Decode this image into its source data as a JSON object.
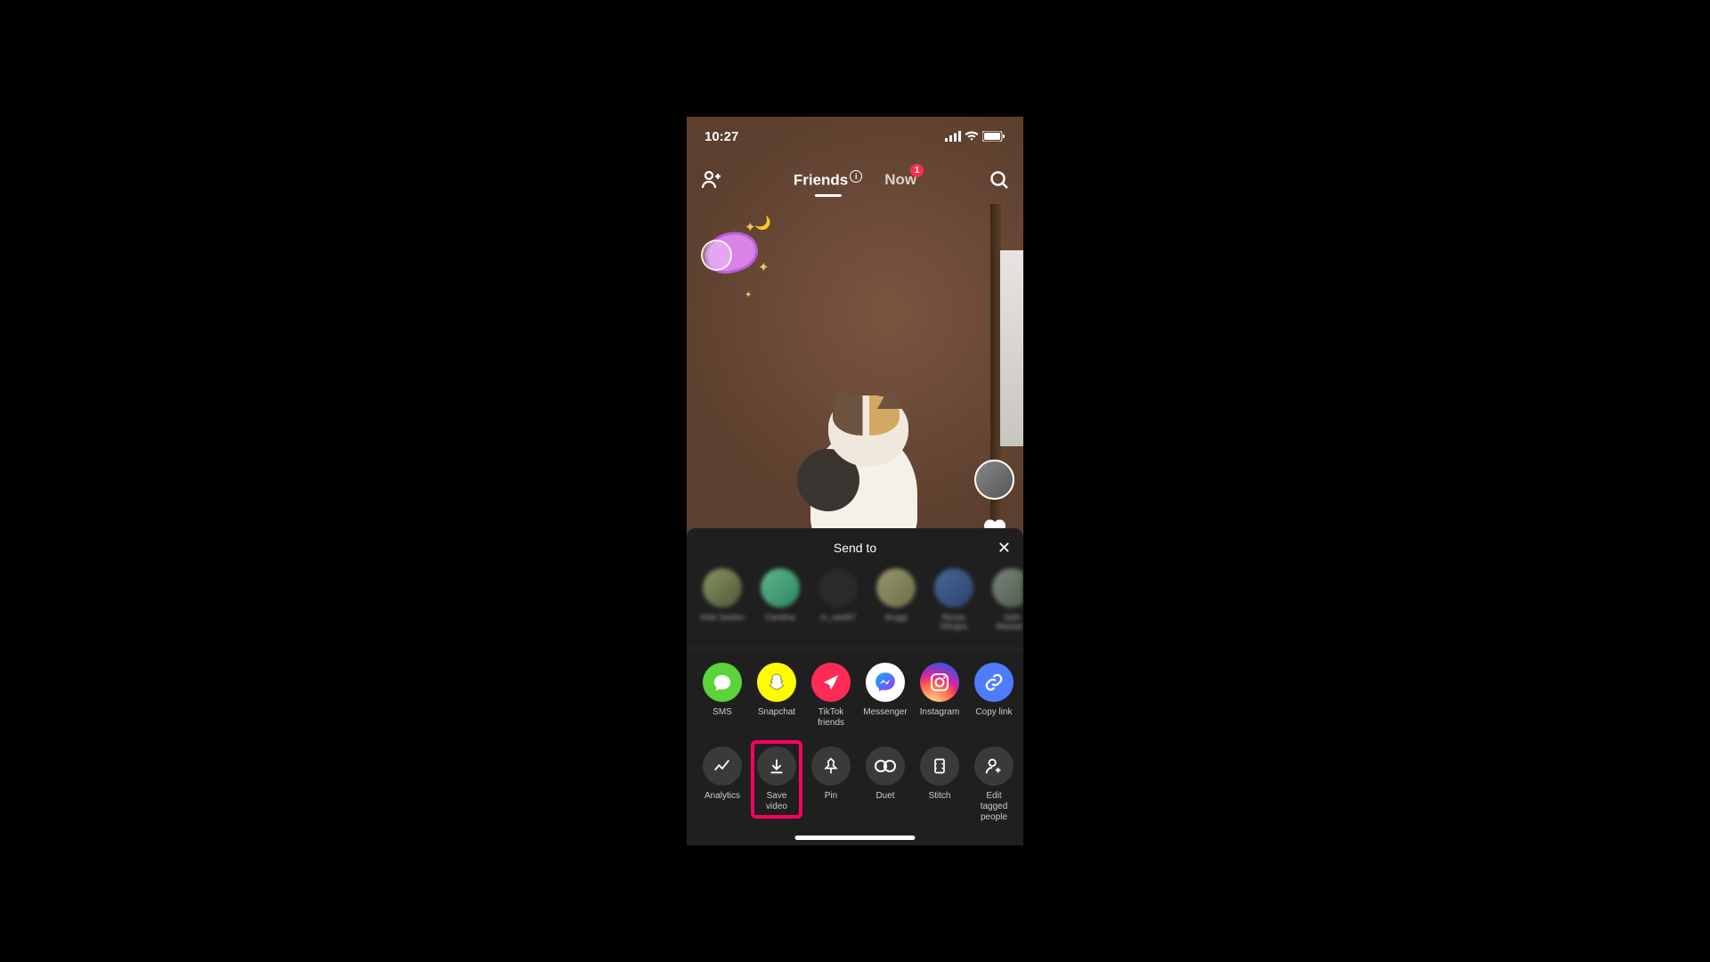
{
  "status": {
    "time": "10:27"
  },
  "nav": {
    "friends_label": "Friends",
    "now_label": "Now",
    "now_badge": "1"
  },
  "share": {
    "title": "Send to",
    "contacts": [
      {
        "name": "Artie Seaton",
        "bg": "linear-gradient(135deg,#8a9565,#4a5a35)"
      },
      {
        "name": "Carolina",
        "bg": "linear-gradient(135deg,#5fb88a,#2d8560)"
      },
      {
        "name": "m_neel67",
        "bg": "#2a2a2a"
      },
      {
        "name": "druggi",
        "bg": "linear-gradient(135deg,#9a9570,#6a7045)"
      },
      {
        "name": "Renan Dhogra",
        "bg": "linear-gradient(135deg,#4a6595,#2a4570)"
      },
      {
        "name": "Seth Massaro",
        "bg": "linear-gradient(135deg,#7a857a,#4a5a4a)"
      }
    ],
    "apps": [
      {
        "label": "SMS",
        "id": "sms"
      },
      {
        "label": "Snapchat",
        "id": "snapchat"
      },
      {
        "label": "TikTok friends",
        "id": "tiktok-friends"
      },
      {
        "label": "Messenger",
        "id": "messenger"
      },
      {
        "label": "Instagram",
        "id": "instagram"
      },
      {
        "label": "Copy link",
        "id": "copy-link"
      }
    ],
    "actions": [
      {
        "label": "Analytics",
        "id": "analytics"
      },
      {
        "label": "Save video",
        "id": "save-video"
      },
      {
        "label": "Pin",
        "id": "pin"
      },
      {
        "label": "Duet",
        "id": "duet"
      },
      {
        "label": "Stitch",
        "id": "stitch"
      },
      {
        "label": "Edit tagged people",
        "id": "edit-tagged"
      }
    ]
  }
}
